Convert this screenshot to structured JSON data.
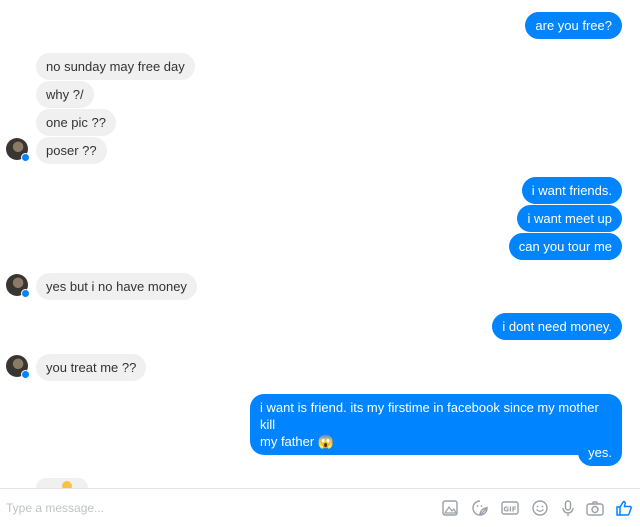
{
  "messages": [
    {
      "side": "out",
      "text": "are you free?"
    },
    {
      "side": "in",
      "text": "no sunday may free day"
    },
    {
      "side": "in",
      "text": "why ?/"
    },
    {
      "side": "in",
      "text": "one pic ??"
    },
    {
      "side": "in",
      "text": "poser ??"
    },
    {
      "side": "out",
      "text": "i want friends."
    },
    {
      "side": "out",
      "text": "i want meet up"
    },
    {
      "side": "out",
      "text": "can you tour me"
    },
    {
      "side": "in",
      "text": "yes but i no have money"
    },
    {
      "side": "out",
      "text": "i dont need money."
    },
    {
      "side": "in",
      "text": "you treat me ??"
    },
    {
      "side": "out",
      "text": "i want is friend. its my firstime in facebook since my mother kill"
    },
    {
      "side": "out",
      "text": "my father 😱"
    },
    {
      "side": "out",
      "text": "yes."
    }
  ],
  "composer": {
    "placeholder": "Type a message...",
    "icons": [
      "image-icon",
      "sticker-icon",
      "gif-icon",
      "emoji-icon",
      "microphone-icon",
      "camera-icon",
      "thumbs-up-icon"
    ]
  },
  "colors": {
    "outgoing": "#0084ff",
    "incoming": "#f1f0f0",
    "accent": "#0084ff"
  }
}
